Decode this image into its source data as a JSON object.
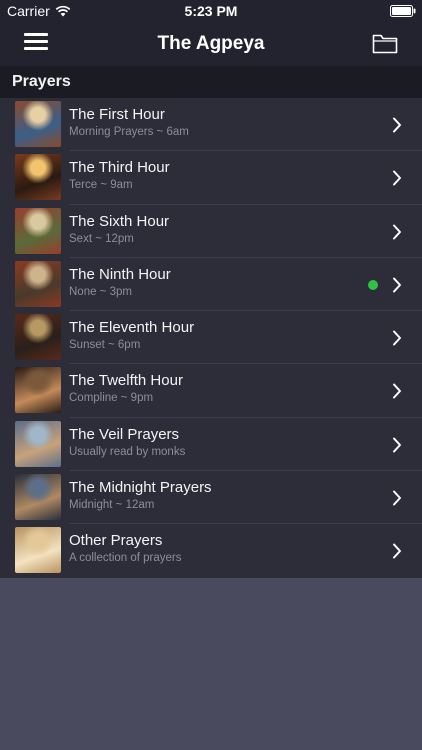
{
  "status_bar": {
    "carrier": "Carrier",
    "time": "5:23 PM"
  },
  "nav": {
    "title": "The Agpeya",
    "left_icon": "menu-icon",
    "right_icon": "folder-icon"
  },
  "section": {
    "title": "Prayers"
  },
  "colors": {
    "background": "#4a4a5e",
    "bar": "#232330",
    "list_bg": "#2d2d3a",
    "active_dot": "#2fc244"
  },
  "prayers": [
    {
      "title": "The First Hour",
      "subtitle": "Morning Prayers ~ 6am",
      "thumb_colors": [
        "#e6d0a4",
        "#8b4a2c",
        "#3a5f8a"
      ],
      "active": false
    },
    {
      "title": "The Third Hour",
      "subtitle": "Terce ~ 9am",
      "thumb_colors": [
        "#f1c46d",
        "#7a3b1f",
        "#2b1a10"
      ],
      "active": false
    },
    {
      "title": "The Sixth Hour",
      "subtitle": "Sext ~ 12pm",
      "thumb_colors": [
        "#d8c9a0",
        "#9a3d2d",
        "#5a6b3a"
      ],
      "active": false
    },
    {
      "title": "The Ninth Hour",
      "subtitle": "None ~ 3pm",
      "thumb_colors": [
        "#cdb48a",
        "#8c3a22",
        "#4a3a2c"
      ],
      "active": true
    },
    {
      "title": "The Eleventh Hour",
      "subtitle": "Sunset ~ 6pm",
      "thumb_colors": [
        "#b79a63",
        "#5a2a1a",
        "#2a1f1a"
      ],
      "active": false
    },
    {
      "title": "The Twelfth Hour",
      "subtitle": "Compline ~ 9pm",
      "thumb_colors": [
        "#7a5a3a",
        "#2a1a14",
        "#c48a5a"
      ],
      "active": false
    },
    {
      "title": "The Veil Prayers",
      "subtitle": "Usually read by monks",
      "thumb_colors": [
        "#9fb7c8",
        "#5a6f8a",
        "#c9a27a"
      ],
      "active": false
    },
    {
      "title": "The Midnight Prayers",
      "subtitle": "Midnight ~ 12am",
      "thumb_colors": [
        "#5c6f8a",
        "#2a2f3c",
        "#b08a62"
      ],
      "active": false
    },
    {
      "title": "Other Prayers",
      "subtitle": "A collection of prayers",
      "thumb_colors": [
        "#e3c99a",
        "#b8925f",
        "#f4e2c0"
      ],
      "active": false
    }
  ]
}
